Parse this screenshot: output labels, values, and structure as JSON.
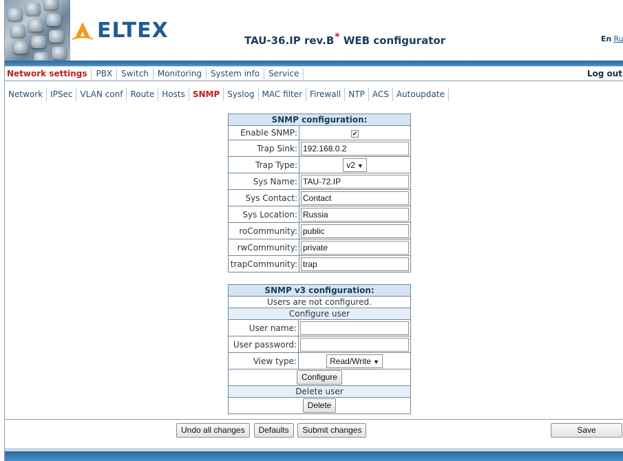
{
  "header": {
    "logo_text": "ELTEX",
    "title": "TAU-36.IP rev.B",
    "title_mark": "*",
    "title_suffix": "WEB configurator",
    "lang_current": "En",
    "lang_other": "Ru"
  },
  "main_tabs": [
    "Network settings",
    "PBX",
    "Switch",
    "Monitoring",
    "System info",
    "Service"
  ],
  "logout_label": "Log out",
  "sub_tabs": [
    "Network",
    "IPSec",
    "VLAN conf",
    "Route",
    "Hosts",
    "SNMP",
    "Syslog",
    "MAC filter",
    "Firewall",
    "NTP",
    "ACS",
    "Autoupdate"
  ],
  "snmp": {
    "title": "SNMP configuration:",
    "enable_label": "Enable SNMP:",
    "enable_checked": true,
    "trap_sink_label": "Trap Sink:",
    "trap_sink_value": "192.168.0.2",
    "trap_type_label": "Trap Type:",
    "trap_type_value": "v2",
    "sys_name_label": "Sys Name:",
    "sys_name_value": "TAU-72.IP",
    "sys_contact_label": "Sys Contact:",
    "sys_contact_value": "Contact",
    "sys_location_label": "Sys Location:",
    "sys_location_value": "Russia",
    "ro_label": "roCommunity:",
    "ro_value": "public",
    "rw_label": "rwCommunity:",
    "rw_value": "private",
    "trap_comm_label": "trapCommunity:",
    "trap_comm_value": "trap"
  },
  "snmp_v3": {
    "title": "SNMP v3 configuration:",
    "status": "Users are not configured.",
    "configure_user_header": "Configure user",
    "user_name_label": "User name:",
    "user_name_value": "",
    "user_password_label": "User password:",
    "user_password_value": "",
    "view_type_label": "View type:",
    "view_type_value": "Read/Write",
    "configure_button": "Configure",
    "delete_user_header": "Delete user",
    "delete_button": "Delete"
  },
  "footer": {
    "undo_label": "Undo all changes",
    "defaults_label": "Defaults",
    "submit_label": "Submit changes",
    "save_label": "Save"
  },
  "colors": {
    "accent": "#1d5c96",
    "active_tab": "#b9201e",
    "table_header": "#d6e4f3"
  }
}
